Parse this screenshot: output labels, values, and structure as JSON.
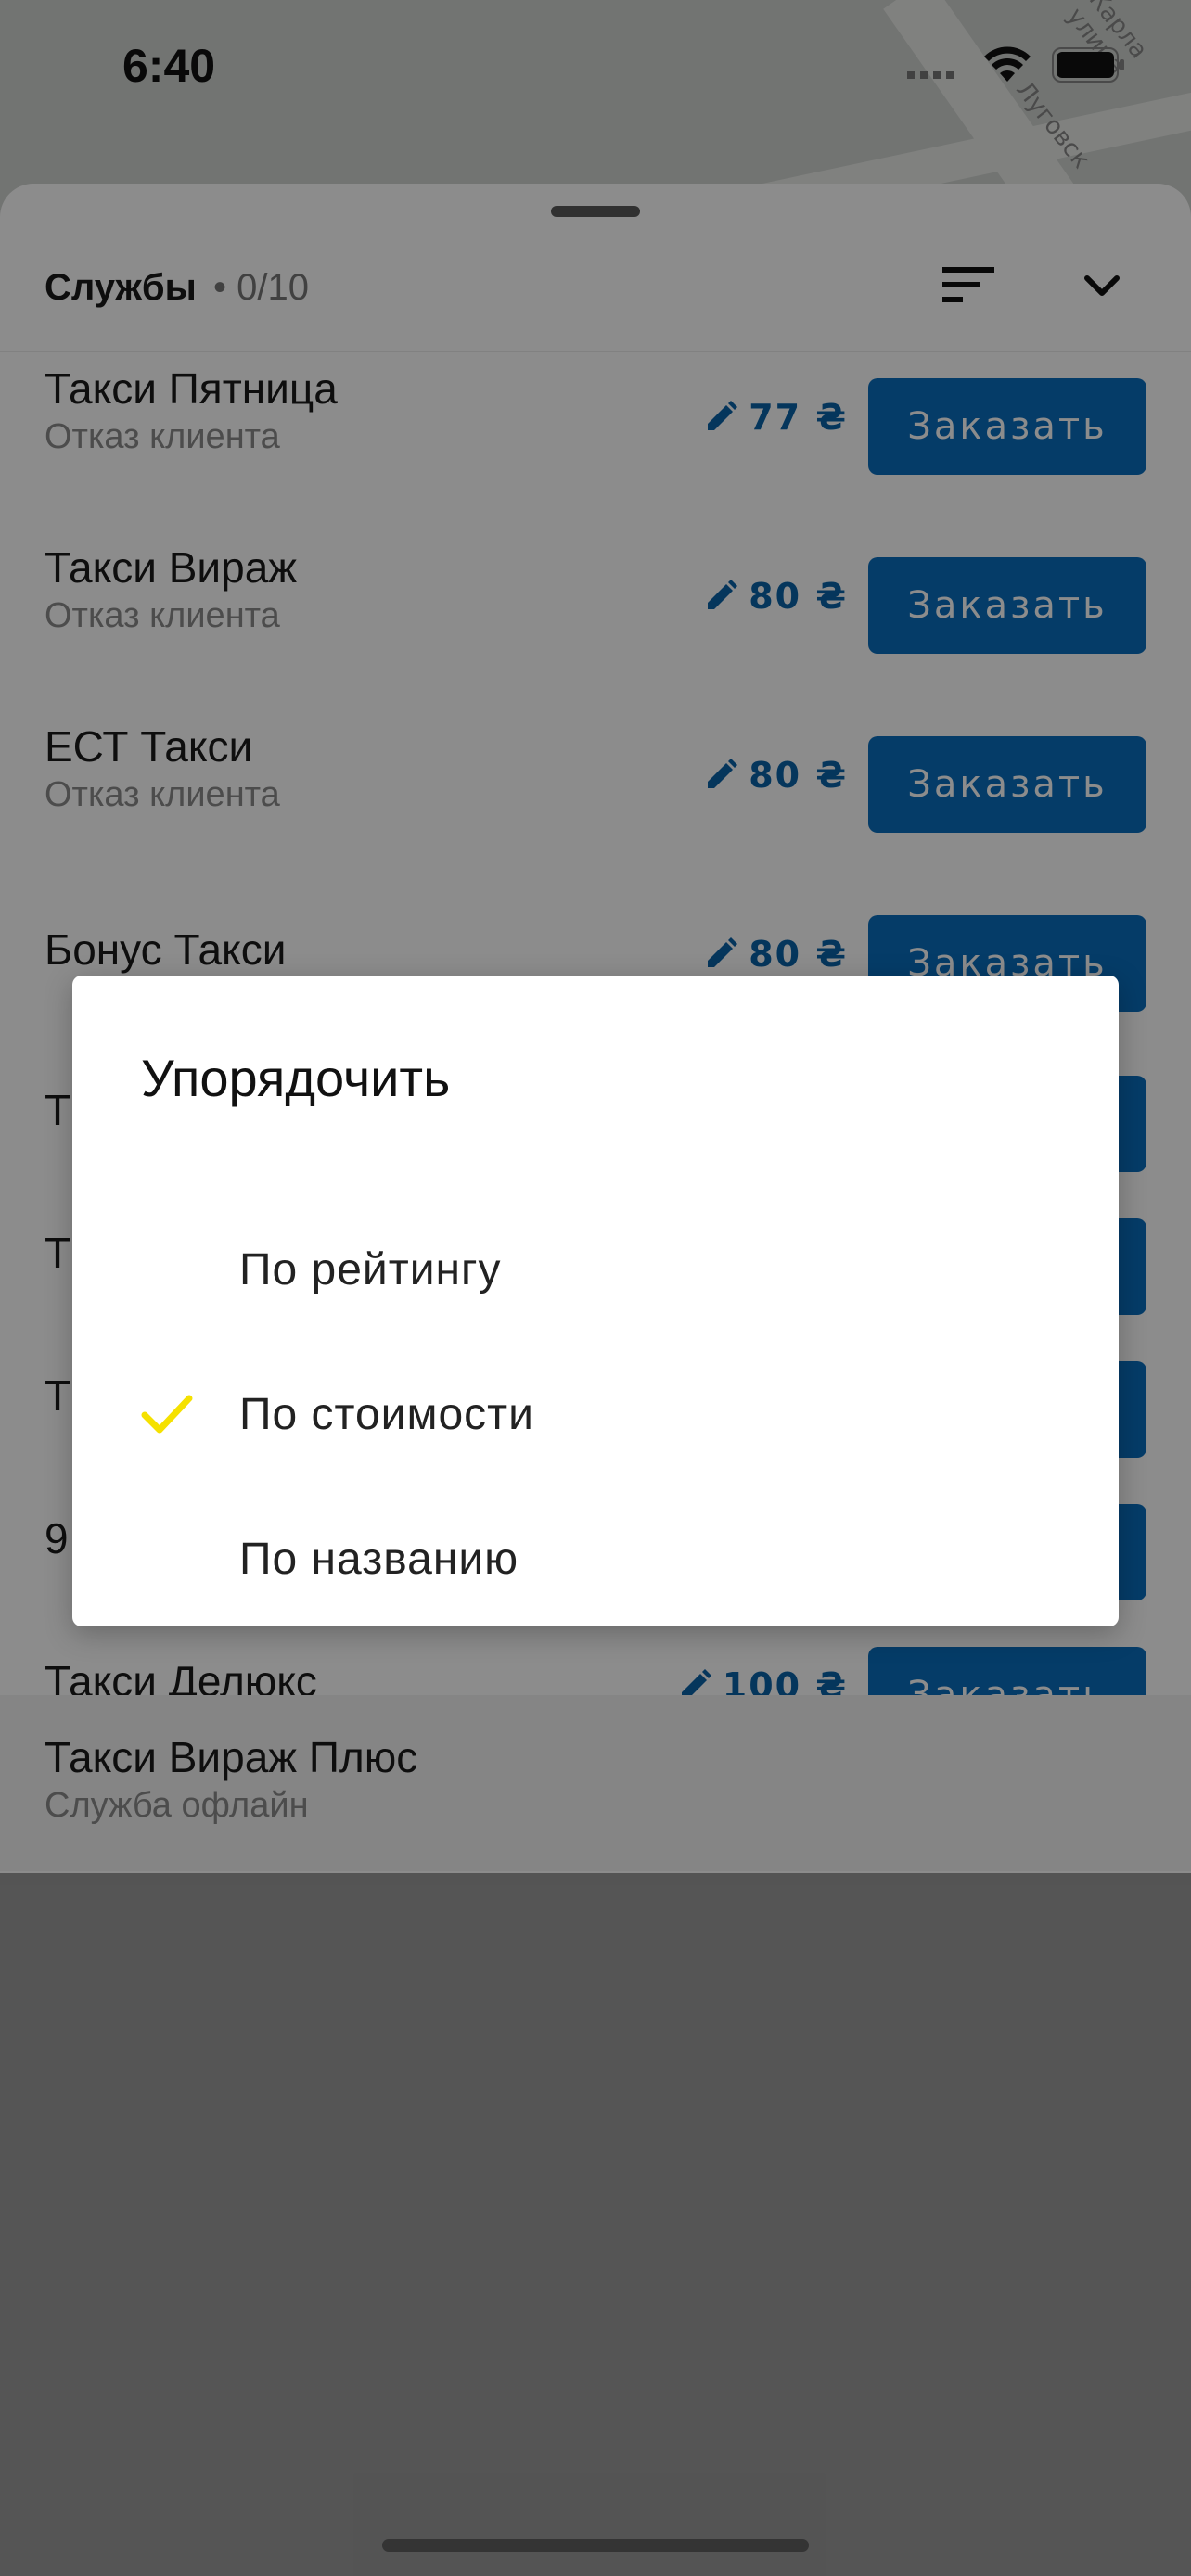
{
  "status_bar": {
    "time": "6:40",
    "icons": [
      "signal-icon",
      "wifi-icon",
      "battery-icon"
    ]
  },
  "map": {
    "street_1": "Карла улица",
    "street_2": "Луговск"
  },
  "sheet": {
    "title": "Службы",
    "count": "• 0/10",
    "sort_icon": "sort-icon",
    "collapse_icon": "chevron-down-icon"
  },
  "services": [
    {
      "name": "Такси Пятница",
      "status": "Отказ клиента",
      "price": "77 ₴",
      "button": "Заказать"
    },
    {
      "name": "Такси Вираж",
      "status": "Отказ клиента",
      "price": "80 ₴",
      "button": "Заказать"
    },
    {
      "name": "ЕСТ Такси",
      "status": "Отказ клиента",
      "price": "80 ₴",
      "button": "Заказать"
    },
    {
      "name": "Бонус Такси",
      "status": "",
      "price": "80 ₴",
      "button": "Заказать"
    },
    {
      "name": "Т",
      "status": "",
      "price": "",
      "button": "Заказать"
    },
    {
      "name": "Т",
      "status": "",
      "price": "",
      "button": "Заказать"
    },
    {
      "name": "Т",
      "status": "",
      "price": "",
      "button": "Заказать"
    },
    {
      "name": "9",
      "status": "",
      "price": "",
      "button": "Заказать"
    },
    {
      "name": "Такси Делюкс",
      "status": "",
      "price": "100 ₴",
      "button": "Заказать"
    }
  ],
  "offline_service": {
    "name": "Такси Вираж Плюс",
    "status": "Служба офлайн"
  },
  "sort_dialog": {
    "title": "Упорядочить",
    "options": [
      {
        "label": "По рейтингу",
        "selected": false
      },
      {
        "label": "По стоимости",
        "selected": true
      },
      {
        "label": "По названию",
        "selected": false
      }
    ],
    "check_color": "#f5e100"
  },
  "colors": {
    "accent": "#0a6dbd",
    "price": "#0a63a8"
  }
}
